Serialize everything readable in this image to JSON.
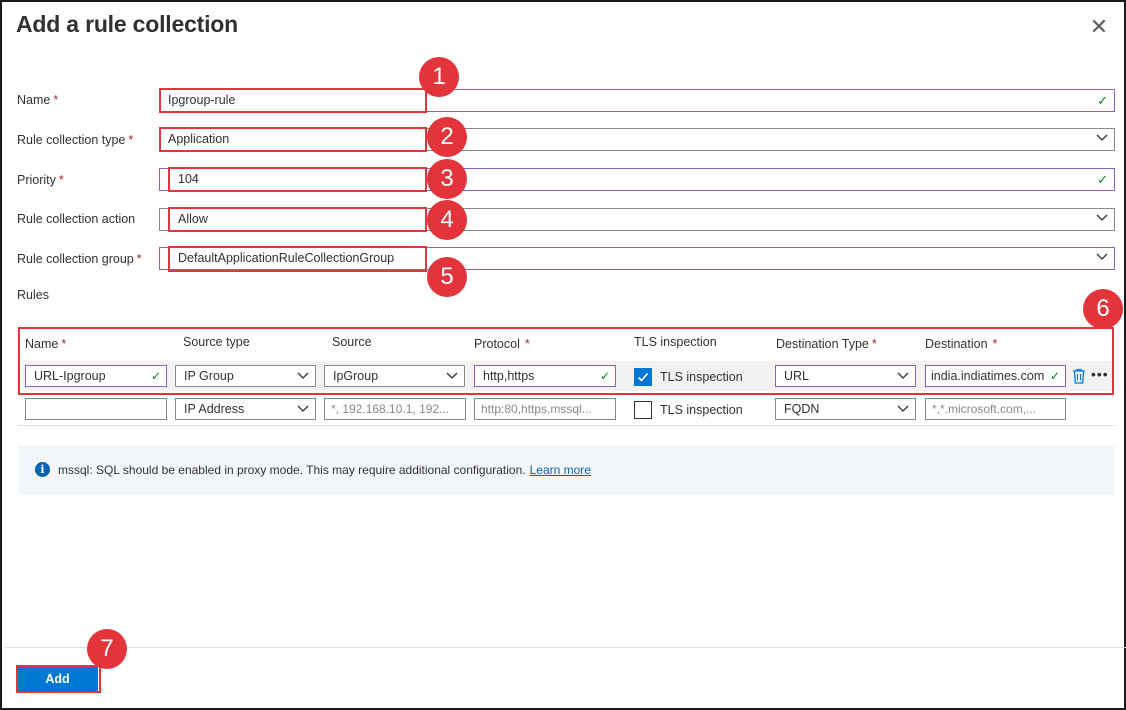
{
  "dialog": {
    "title": "Add a rule collection"
  },
  "form": {
    "name_label": "Name",
    "name_value": "Ipgroup-rule",
    "type_label": "Rule collection type",
    "type_value": "Application",
    "priority_label": "Priority",
    "priority_value": "104",
    "action_label": "Rule collection action",
    "action_value": "Allow",
    "group_label": "Rule collection group",
    "group_value": "DefaultApplicationRuleCollectionGroup",
    "required_mark": "*"
  },
  "rules": {
    "section_label": "Rules",
    "columns": [
      "Name",
      "Source type",
      "Source",
      "Protocol",
      "TLS inspection",
      "Destination Type",
      "Destination"
    ],
    "required_columns": [
      true,
      false,
      false,
      true,
      false,
      true,
      true
    ],
    "row1": {
      "name": "URL-Ipgroup",
      "source_type": "IP Group",
      "source": "IpGroup",
      "protocol": "http,https",
      "tls_label": "TLS inspection",
      "tls_checked": true,
      "destination_type": "URL",
      "destination": "india.indiatimes.com"
    },
    "row2": {
      "name": "",
      "source_type": "IP Address",
      "source_placeholder": "*, 192.168.10.1, 192...",
      "protocol_placeholder": "http:80,https,mssql...",
      "tls_label": "TLS inspection",
      "tls_checked": false,
      "destination_type": "FQDN",
      "destination_placeholder": "*,*.microsoft.com,..."
    }
  },
  "info": {
    "text": "mssql: SQL should be enabled in proxy mode. This may require additional configuration.",
    "link": "Learn more"
  },
  "footer": {
    "add_label": "Add"
  },
  "callouts": [
    "1",
    "2",
    "3",
    "4",
    "5",
    "6",
    "7"
  ],
  "colors": {
    "highlight": "#e3343c",
    "primary": "#0078d4",
    "valid_border": "#8764b8",
    "check": "#107c10"
  }
}
